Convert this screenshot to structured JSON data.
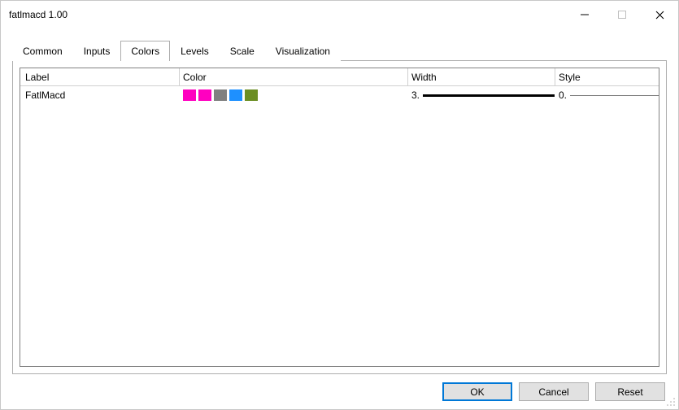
{
  "window": {
    "title": "fatlmacd 1.00"
  },
  "tabs": [
    {
      "id": "common",
      "label": "Common",
      "active": false
    },
    {
      "id": "inputs",
      "label": "Inputs",
      "active": false
    },
    {
      "id": "colors",
      "label": "Colors",
      "active": true
    },
    {
      "id": "levels",
      "label": "Levels",
      "active": false
    },
    {
      "id": "scale",
      "label": "Scale",
      "active": false
    },
    {
      "id": "visualization",
      "label": "Visualization",
      "active": false
    }
  ],
  "grid": {
    "headers": {
      "label": "Label",
      "color": "Color",
      "width": "Width",
      "style": "Style"
    },
    "rows": [
      {
        "label": "FatlMacd",
        "colors": [
          "#ff00c0",
          "#ff00c0",
          "#808080",
          "#1e90ff",
          "#6b8e23"
        ],
        "width_value": "3.",
        "style_value": "0."
      }
    ]
  },
  "buttons": {
    "ok": "OK",
    "cancel": "Cancel",
    "reset": "Reset"
  }
}
